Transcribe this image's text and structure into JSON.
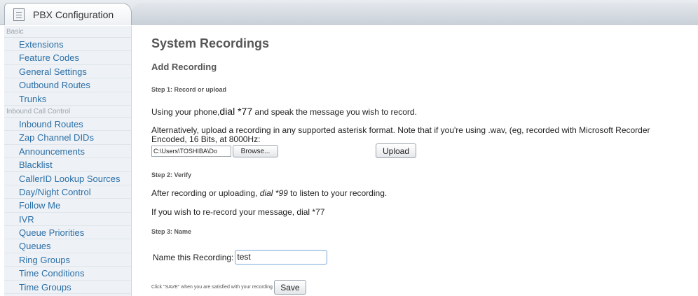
{
  "tab": {
    "label": "PBX Configuration"
  },
  "sidebar": {
    "sections": [
      {
        "title": "Basic",
        "items": [
          "Extensions",
          "Feature Codes",
          "General Settings",
          "Outbound Routes",
          "Trunks"
        ]
      },
      {
        "title": "Inbound Call Control",
        "items": [
          "Inbound Routes",
          "Zap Channel DIDs",
          "Announcements",
          "Blacklist",
          "CallerID Lookup Sources",
          "Day/Night Control",
          "Follow Me",
          "IVR",
          "Queue Priorities",
          "Queues",
          "Ring Groups",
          "Time Conditions",
          "Time Groups"
        ]
      }
    ]
  },
  "main": {
    "title": "System Recordings",
    "subtitle": "Add Recording",
    "step1": "Step 1: Record or upload",
    "phone_pre": "Using your phone,",
    "phone_dial": "dial *77",
    "phone_post": " and speak the message you wish to record.",
    "alt_line1": "Alternatively, upload a recording in any supported asterisk format. Note that if you're using .wav, (eg, recorded with Microsoft Recorder",
    "alt_line2": "Encoded, 16 Bits, at 8000Hz:",
    "file_path": "C:\\Users\\TOSHIBA\\Do",
    "browse_label": "Browse...",
    "upload_label": "Upload",
    "step2": "Step 2: Verify",
    "verify_pre": "After recording or uploading, ",
    "verify_dial": "dial *99",
    "verify_post": " to listen to your recording.",
    "rerecord": "If you wish to re-record your message, dial *77",
    "step3": "Step 3: Name",
    "name_label": "Name this Recording:",
    "name_value": "test",
    "save_note": "Click \"SAVE\" when you are satisfied with your recording",
    "save_label": "Save"
  }
}
